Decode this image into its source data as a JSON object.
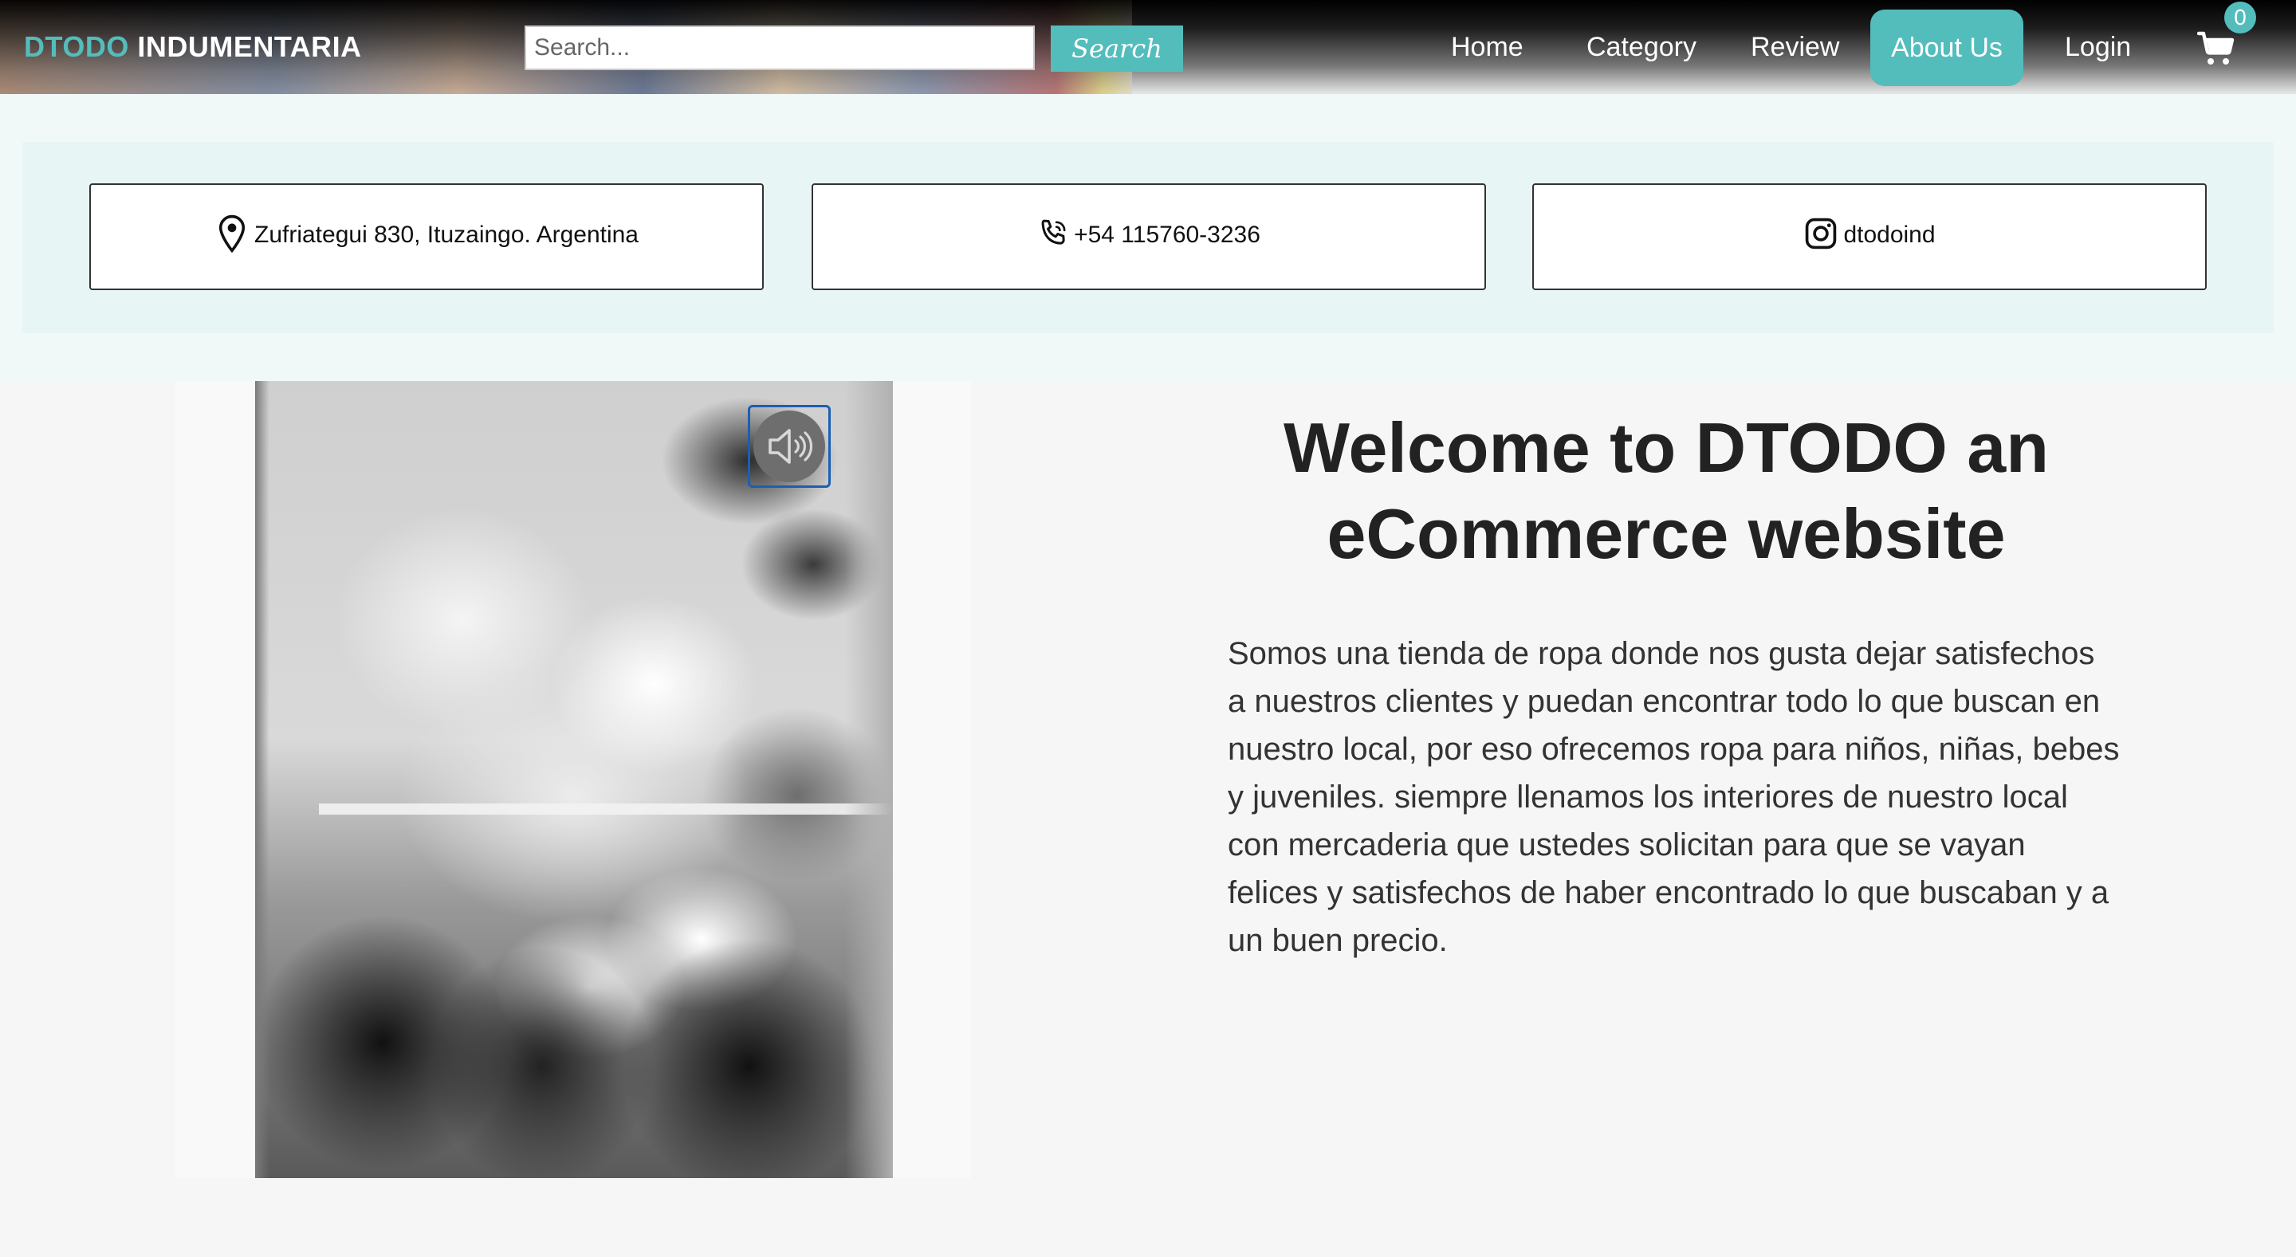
{
  "navbar": {
    "brand_part1": "DTODO",
    "brand_part2": "INDUMENTARIA",
    "search_placeholder": "Search...",
    "search_button": "Search",
    "links": {
      "home": "Home",
      "category": "Category",
      "review": "Review",
      "about": "About Us",
      "login": "Login"
    },
    "cart_count": "0"
  },
  "contact": {
    "address": "Zufriategui 830, Ituzaingo. Argentina",
    "phone": "+54 115760-3236",
    "instagram": "dtodoind"
  },
  "main": {
    "title": "Welcome to DTODO an eCommerce website",
    "description": "Somos una tienda de ropa donde nos gusta dejar satisfechos a nuestros clientes y puedan encontrar todo lo que buscan en nuestro local, por eso ofrecemos ropa para niños, niñas, bebes y juveniles. siempre llenamos los interiores de nuestro local con mercaderia que ustedes solicitan para que se vayan felices y satisfechos de haber encontrado lo que buscaban y a un buen precio."
  },
  "icons": {
    "location": "map-pin-icon",
    "phone": "phone-icon",
    "instagram": "instagram-icon",
    "cart": "shopping-cart-icon",
    "mute": "speaker-icon"
  },
  "colors": {
    "accent": "#53bdbc",
    "contact_band": "#e8f5f5",
    "page_bg": "#f6f6f6"
  }
}
